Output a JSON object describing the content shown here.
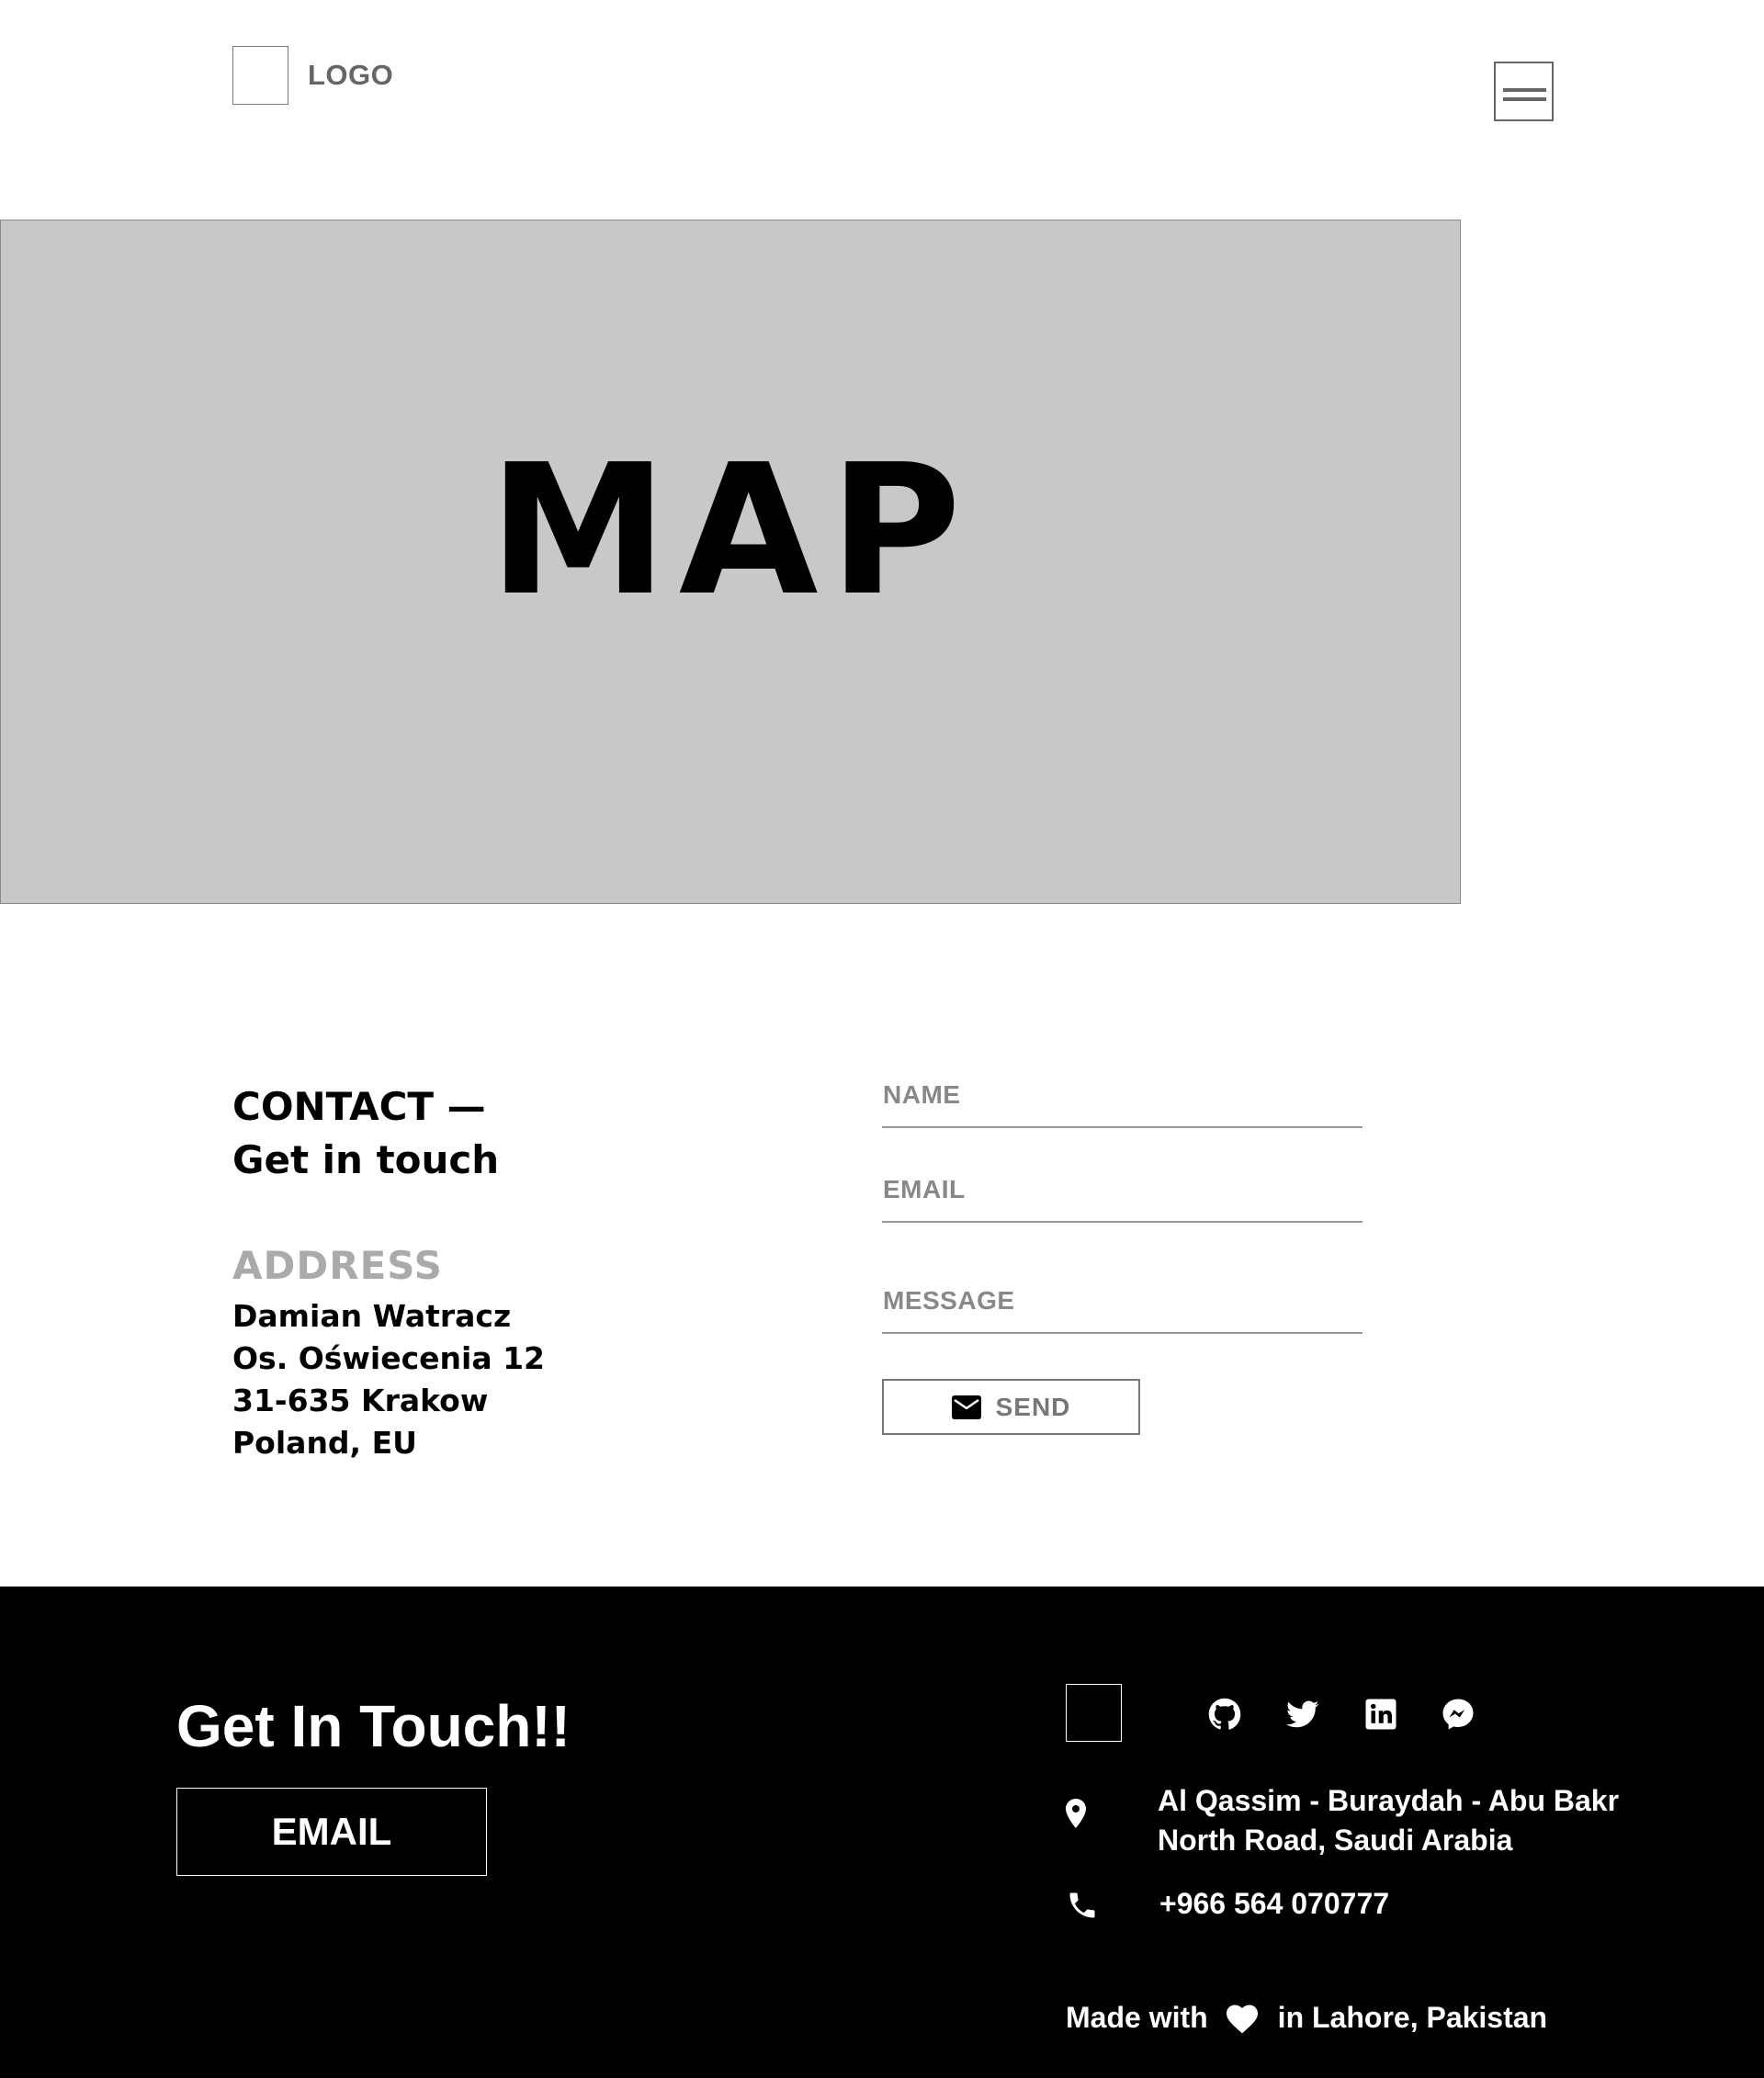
{
  "header": {
    "logo_text": "LOGO",
    "menu_icon": "hamburger-menu-icon"
  },
  "map": {
    "label": "MAP"
  },
  "contact": {
    "heading_line1": "CONTACT —",
    "heading_line2": "Get in touch",
    "address_title": "ADDRESS",
    "address_lines": [
      "Damian Watracz",
      "Os. Oświecenia 12",
      "31-635 Krakow",
      "Poland, EU"
    ]
  },
  "form": {
    "name_placeholder": "NAME",
    "email_placeholder": "EMAIL",
    "message_placeholder": "MESSAGE",
    "send_label": "SEND",
    "send_icon": "mail-icon"
  },
  "footer": {
    "title": "Get In Touch!!",
    "email_button": "EMAIL",
    "social_icons": [
      "github-icon",
      "twitter-icon",
      "linkedin-icon",
      "messenger-icon"
    ],
    "address_line1": "Al Qassim - Buraydah - Abu Bakr",
    "address_line2": "North Road, Saudi Arabia",
    "phone": "+966 564 070777",
    "made_with_prefix": "Made with",
    "made_with_suffix": "in Lahore, Pakistan"
  },
  "colors": {
    "footer_bg": "#000000",
    "map_bg": "#c8c8c8",
    "muted_text": "#777777",
    "address_title": "#aaaaaa"
  }
}
